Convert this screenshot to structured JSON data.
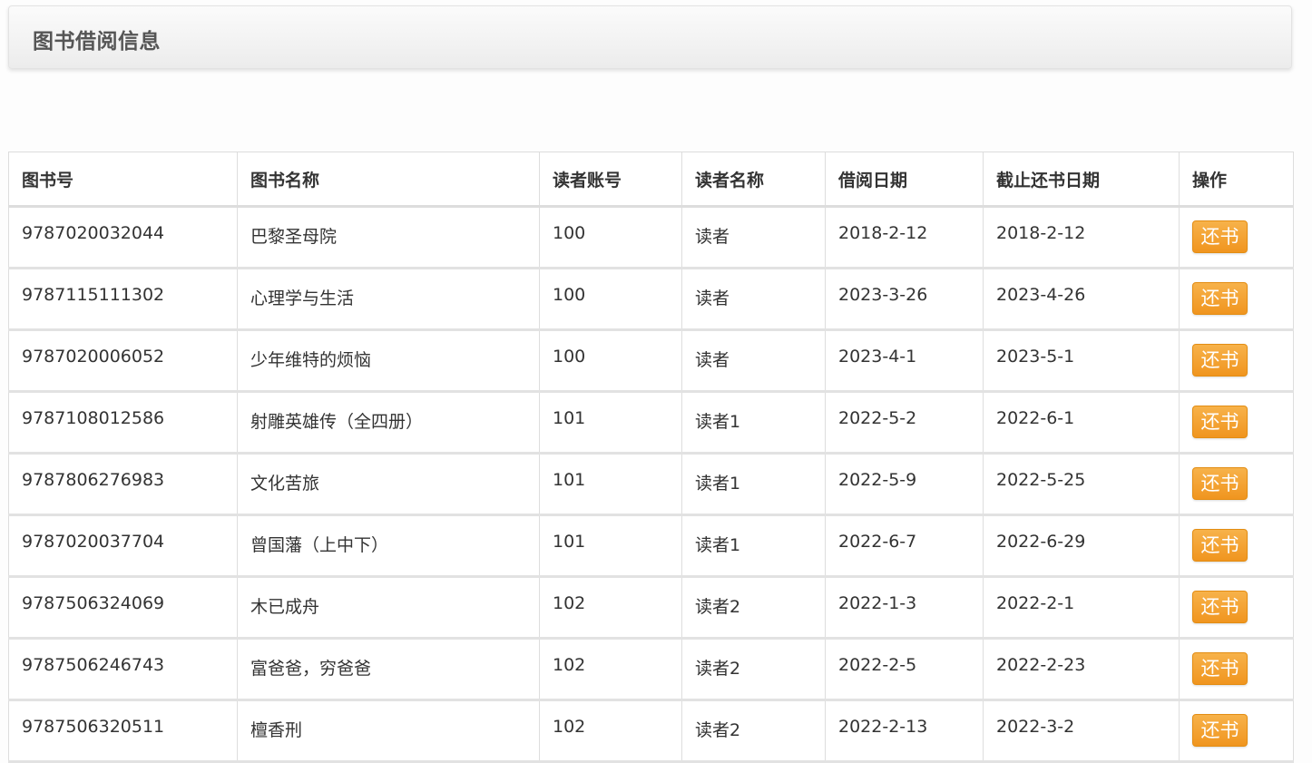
{
  "page": {
    "title": "图书借阅信息"
  },
  "table": {
    "headers": [
      "图书号",
      "图书名称",
      "读者账号",
      "读者名称",
      "借阅日期",
      "截止还书日期",
      "操作"
    ],
    "rows": [
      {
        "isbn": "9787020032044",
        "book_name": "巴黎圣母院",
        "reader_account": "100",
        "reader_name": "读者",
        "borrow_date": "2018-2-12",
        "due_date": "2018-2-12",
        "action": "还书"
      },
      {
        "isbn": "9787115111302",
        "book_name": "心理学与生活",
        "reader_account": "100",
        "reader_name": "读者",
        "borrow_date": "2023-3-26",
        "due_date": "2023-4-26",
        "action": "还书"
      },
      {
        "isbn": "9787020006052",
        "book_name": "少年维特的烦恼",
        "reader_account": "100",
        "reader_name": "读者",
        "borrow_date": "2023-4-1",
        "due_date": "2023-5-1",
        "action": "还书"
      },
      {
        "isbn": "9787108012586",
        "book_name": "射雕英雄传（全四册）",
        "reader_account": "101",
        "reader_name": "读者1",
        "borrow_date": "2022-5-2",
        "due_date": "2022-6-1",
        "action": "还书"
      },
      {
        "isbn": "9787806276983",
        "book_name": "文化苦旅",
        "reader_account": "101",
        "reader_name": "读者1",
        "borrow_date": "2022-5-9",
        "due_date": "2022-5-25",
        "action": "还书"
      },
      {
        "isbn": "9787020037704",
        "book_name": "曾国藩（上中下）",
        "reader_account": "101",
        "reader_name": "读者1",
        "borrow_date": "2022-6-7",
        "due_date": "2022-6-29",
        "action": "还书"
      },
      {
        "isbn": "9787506324069",
        "book_name": "木已成舟",
        "reader_account": "102",
        "reader_name": "读者2",
        "borrow_date": "2022-1-3",
        "due_date": "2022-2-1",
        "action": "还书"
      },
      {
        "isbn": "9787506246743",
        "book_name": "富爸爸，穷爸爸",
        "reader_account": "102",
        "reader_name": "读者2",
        "borrow_date": "2022-2-5",
        "due_date": "2022-2-23",
        "action": "还书"
      },
      {
        "isbn": "9787506320511",
        "book_name": "檀香刑",
        "reader_account": "102",
        "reader_name": "读者2",
        "borrow_date": "2022-2-13",
        "due_date": "2022-3-2",
        "action": "还书"
      }
    ]
  },
  "colors": {
    "button_bg": "#f0951f",
    "button_text": "#ffffff",
    "border": "#dddddd"
  }
}
